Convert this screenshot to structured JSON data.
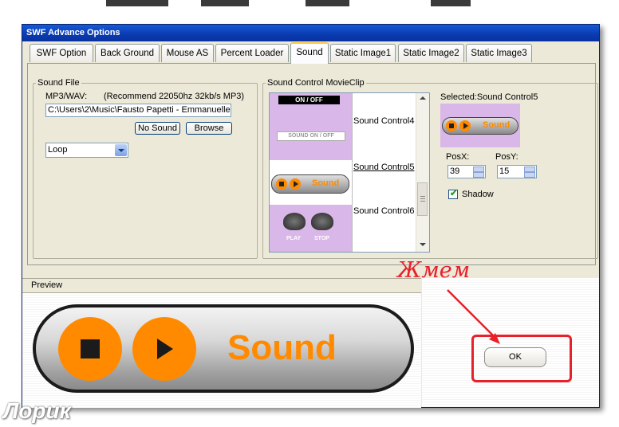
{
  "window": {
    "title": "SWF Advance Options"
  },
  "tabs": [
    {
      "label": "SWF Option"
    },
    {
      "label": "Back Ground"
    },
    {
      "label": "Mouse AS"
    },
    {
      "label": "Percent Loader"
    },
    {
      "label": "Sound"
    },
    {
      "label": "Static Image1"
    },
    {
      "label": "Static Image2"
    },
    {
      "label": "Static Image3"
    }
  ],
  "sound_file": {
    "group_label": "Sound File",
    "mp3_label": "MP3/WAV:",
    "recommend": "(Recommend 22050hz 32kb/s MP3)",
    "path_value": "C:\\Users\\2\\Music\\Fausto Papetti - Emmanuelle.",
    "no_sound_label": "No Sound",
    "browse_label": "Browse",
    "mode_value": "Loop"
  },
  "sound_control": {
    "group_label": "Sound Control MovieClip",
    "thumb_onoff": "ON / OFF",
    "thumb_sound_onoff": "SOUND  ON / OFF",
    "thumb_sound": "Sound",
    "thumb_play": "PLAY",
    "thumb_stop": "STOP",
    "items": [
      {
        "label": "Sound Control4"
      },
      {
        "label": "Sound Control5"
      },
      {
        "label": "Sound Control6"
      }
    ]
  },
  "selected": {
    "label": "Selected:Sound Control5",
    "thumb_text": "Sound",
    "posx_label": "PosX:",
    "posy_label": "PosY:",
    "posx_value": "39",
    "posy_value": "15",
    "shadow_label": "Shadow",
    "shadow_checked": true
  },
  "preview": {
    "label": "Preview",
    "sound_text": "Sound"
  },
  "ok_label": "OK",
  "annotation": {
    "text": "Жмем"
  },
  "watermark": "Лорик",
  "colors": {
    "accent_orange": "#ff8a00",
    "highlight_red": "#e8202a",
    "purple": "#d9b7e8"
  }
}
